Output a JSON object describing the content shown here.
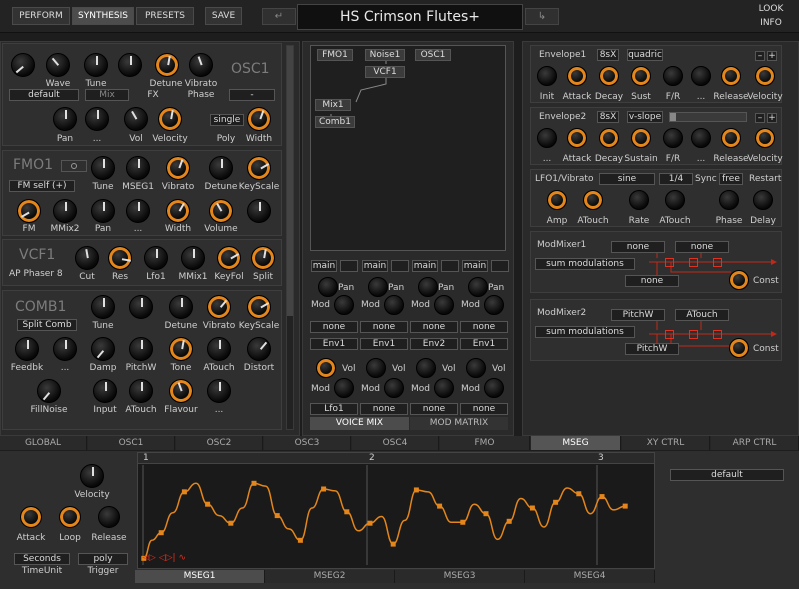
{
  "top": {
    "perform": "PERFORM",
    "synthesis": "SYNTHESIS",
    "presets": "PRESETS",
    "save": "SAVE",
    "preset_name": "HS Crimson Flutes+",
    "look": "LOOK",
    "info": "INFO"
  },
  "osc1": {
    "name": "OSC1",
    "wave": "Wave",
    "tune": "Tune",
    "detune": "Detune",
    "vibrato": "Vibrato",
    "mode": "default",
    "mix": "Mix",
    "fx": "FX",
    "phase": "Phase",
    "dash": "-",
    "pan": "Pan",
    "dots": "...",
    "vol": "Vol",
    "velocity": "Velocity",
    "poly_value": "single",
    "poly": "Poly",
    "width": "Width"
  },
  "fmo1": {
    "name": "FMO1",
    "mode": "FM self (+)",
    "tune": "Tune",
    "mseg1": "MSEG1",
    "vibrato": "Vibrato",
    "detune": "Detune",
    "keyscale": "KeyScale",
    "fm": "FM",
    "mmix2": "MMix2",
    "pan": "Pan",
    "dots": "...",
    "width": "Width",
    "volume": "Volume"
  },
  "vcf1": {
    "name": "VCF1",
    "mode": "AP Phaser 8",
    "cut": "Cut",
    "res": "Res",
    "lfo1": "Lfo1",
    "mmix1": "MMix1",
    "keyfol": "KeyFol",
    "split": "Split"
  },
  "comb1": {
    "name": "COMB1",
    "mode": "Split Comb",
    "tune": "Tune",
    "detune": "Detune",
    "vibrato": "Vibrato",
    "keyscale": "KeyScale",
    "feedbk": "Feedbk",
    "dots": "...",
    "damp": "Damp",
    "pitchw": "PitchW",
    "tone": "Tone",
    "atouch": "ATouch",
    "distort": "Distort",
    "fillnoise": "FillNoise",
    "input": "Input",
    "flavour": "Flavour"
  },
  "matrix": {
    "nodes": [
      "FMO1",
      "Noise1",
      "OSC1",
      "VCF1",
      "Mix1",
      "Comb1"
    ],
    "buses": [
      "main",
      "main",
      "main",
      "main"
    ],
    "pan": "Pan",
    "mod": "Mod",
    "vol": "Vol",
    "row_none": [
      "none",
      "none",
      "none",
      "none"
    ],
    "row_env": [
      "Env1",
      "Env1",
      "Env2",
      "Env1"
    ],
    "row_bottom": [
      "Lfo1",
      "none",
      "none",
      "none"
    ],
    "voice_mix": "VOICE MIX",
    "mod_matrix": "MOD MATRIX"
  },
  "env1": {
    "name": "Envelope1",
    "rate": "8sX",
    "mode": "quadric",
    "init": "Init",
    "attack": "Attack",
    "decay": "Decay",
    "sust": "Sust",
    "fr": "F/R",
    "dots": "...",
    "release": "Release",
    "velocity": "Velocity",
    "minus": "–",
    "plus": "+"
  },
  "env2": {
    "name": "Envelope2",
    "rate": "8sX",
    "mode": "v-slope",
    "dots": "...",
    "attack": "Attack",
    "decay": "Decay",
    "sustain": "Sustain",
    "fr": "F/R",
    "release": "Release",
    "velocity": "Velocity",
    "minus": "–",
    "plus": "+"
  },
  "lfo1": {
    "name": "LFO1/Vibrato",
    "wave": "sine",
    "rate_val": "1/4",
    "sync": "Sync",
    "free": "free",
    "restart": "Restart",
    "amp": "Amp",
    "atouch": "ATouch",
    "rate": "Rate",
    "phase": "Phase",
    "delay": "Delay"
  },
  "modmixer1": {
    "name": "ModMixer1",
    "in1": "none",
    "in2": "none",
    "in3": "none",
    "mode": "sum modulations",
    "const": "Const"
  },
  "modmixer2": {
    "name": "ModMixer2",
    "in1": "PitchW",
    "in2": "ATouch",
    "in3": "PitchW",
    "mode": "sum modulations",
    "const": "Const"
  },
  "tabs": [
    "GLOBAL",
    "OSC1",
    "OSC2",
    "OSC3",
    "OSC4",
    "FMO",
    "MSEG",
    "XY CTRL",
    "ARP CTRL"
  ],
  "mseg": {
    "velocity": "Velocity",
    "attack": "Attack",
    "loop": "Loop",
    "release": "Release",
    "timeunit_value": "Seconds",
    "timeunit": "TimeUnit",
    "trigger_value": "poly",
    "trigger": "Trigger",
    "markers": [
      "1",
      "2",
      "3"
    ],
    "preset": "default",
    "subtabs": [
      "MSEG1",
      "MSEG2",
      "MSEG3",
      "MSEG4"
    ],
    "points": [
      [
        0.5,
        7
      ],
      [
        1.2,
        26
      ],
      [
        2,
        34
      ],
      [
        3,
        55
      ],
      [
        4,
        77
      ],
      [
        5,
        86
      ],
      [
        6,
        64
      ],
      [
        7,
        52
      ],
      [
        8,
        44
      ],
      [
        9,
        60
      ],
      [
        10,
        86
      ],
      [
        11,
        83
      ],
      [
        12,
        52
      ],
      [
        13,
        38
      ],
      [
        14,
        26
      ],
      [
        15,
        60
      ],
      [
        16,
        80
      ],
      [
        17,
        78
      ],
      [
        18,
        56
      ],
      [
        19,
        36
      ],
      [
        20,
        44
      ],
      [
        21,
        51
      ],
      [
        22,
        22
      ],
      [
        23,
        47
      ],
      [
        24,
        79
      ],
      [
        25,
        77
      ],
      [
        26,
        62
      ],
      [
        27,
        45
      ],
      [
        28,
        45
      ],
      [
        29,
        64
      ],
      [
        30,
        54
      ],
      [
        31,
        27
      ],
      [
        32,
        46
      ],
      [
        33,
        70
      ],
      [
        34,
        60
      ],
      [
        35,
        40
      ],
      [
        36,
        66
      ],
      [
        37,
        81
      ],
      [
        38,
        75
      ],
      [
        39,
        54
      ],
      [
        40,
        72
      ],
      [
        41,
        58
      ],
      [
        42,
        62
      ]
    ]
  }
}
